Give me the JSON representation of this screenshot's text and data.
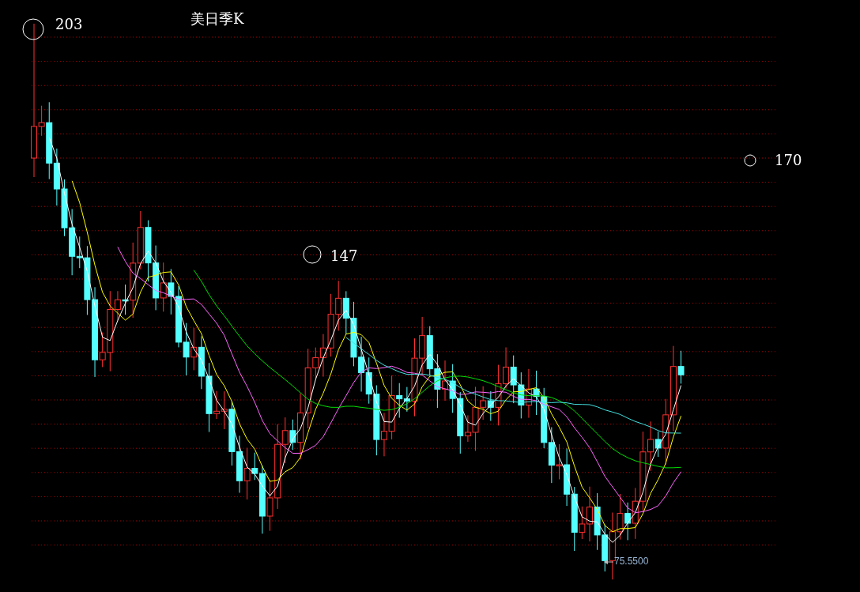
{
  "chart": {
    "title": "美日季K",
    "markers": [
      {
        "label": "203"
      },
      {
        "label": "147"
      },
      {
        "label": "170"
      }
    ],
    "low_label": "75.5500"
  }
}
